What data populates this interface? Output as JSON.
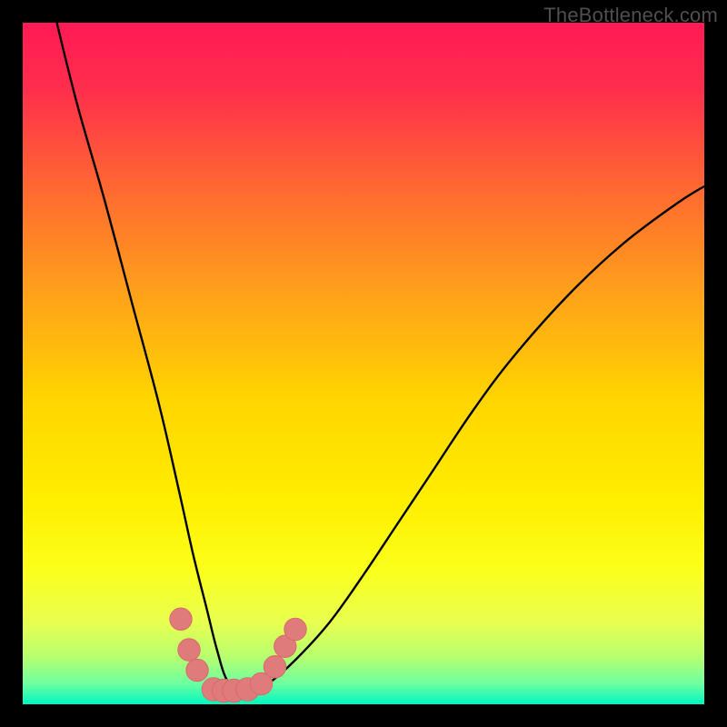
{
  "watermark": "TheBottleneck.com",
  "colors": {
    "black": "#000000",
    "curve": "#000000",
    "marker_fill": "#e07b7b",
    "marker_stroke": "#d86a6a",
    "gradient_stops": [
      {
        "offset": 0.0,
        "color": "#ff1a55"
      },
      {
        "offset": 0.1,
        "color": "#ff2f4c"
      },
      {
        "offset": 0.25,
        "color": "#ff6b30"
      },
      {
        "offset": 0.4,
        "color": "#ffa21a"
      },
      {
        "offset": 0.55,
        "color": "#ffd400"
      },
      {
        "offset": 0.7,
        "color": "#ffee00"
      },
      {
        "offset": 0.8,
        "color": "#fbff1a"
      },
      {
        "offset": 0.88,
        "color": "#e8ff50"
      },
      {
        "offset": 0.93,
        "color": "#b8ff70"
      },
      {
        "offset": 0.97,
        "color": "#6cffa0"
      },
      {
        "offset": 1.0,
        "color": "#00f7c1"
      }
    ]
  },
  "chart_data": {
    "type": "line",
    "title": "",
    "xlabel": "",
    "ylabel": "",
    "xlim": [
      0,
      100
    ],
    "ylim": [
      0,
      100
    ],
    "legend": false,
    "grid": false,
    "series": [
      {
        "name": "bottleneck-curve",
        "x": [
          5,
          8,
          12,
          16,
          20,
          23,
          25,
          27,
          28.5,
          30,
          32,
          34,
          36,
          40,
          45,
          50,
          55,
          60,
          66,
          72,
          80,
          88,
          96,
          100
        ],
        "y": [
          100,
          88,
          74,
          59,
          44,
          31,
          22,
          14,
          8,
          3.5,
          2,
          2,
          3,
          6.5,
          12,
          19,
          26.5,
          34,
          43,
          51,
          60,
          67.5,
          73.5,
          76
        ]
      }
    ],
    "markers": [
      {
        "x": 23.2,
        "y": 12.5,
        "r": 1.2
      },
      {
        "x": 24.4,
        "y": 8.0,
        "r": 1.2
      },
      {
        "x": 25.6,
        "y": 5.0,
        "r": 1.2
      },
      {
        "x": 28.0,
        "y": 2.2,
        "r": 1.3
      },
      {
        "x": 29.5,
        "y": 2.0,
        "r": 1.3
      },
      {
        "x": 31.0,
        "y": 2.0,
        "r": 1.3
      },
      {
        "x": 33.0,
        "y": 2.2,
        "r": 1.3
      },
      {
        "x": 35.0,
        "y": 3.0,
        "r": 1.2
      },
      {
        "x": 37.0,
        "y": 5.5,
        "r": 1.2
      },
      {
        "x": 38.5,
        "y": 8.5,
        "r": 1.2
      },
      {
        "x": 40.0,
        "y": 11.0,
        "r": 1.2
      }
    ],
    "annotations": []
  }
}
